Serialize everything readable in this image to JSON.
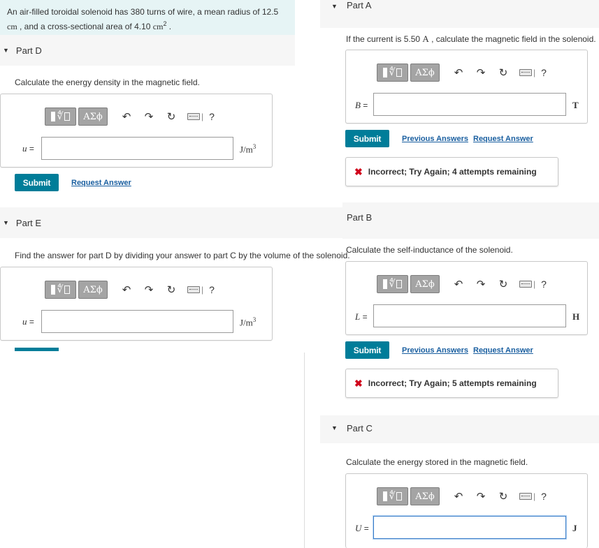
{
  "problem": {
    "line1": "An air-filled toroidal solenoid has 380 turns of wire, a mean radius of 12.5",
    "unit_cm": "cm",
    "line2_mid": " , and a cross-sectional area of 4.10 ",
    "unit_cm2": "cm",
    "sup2": "2",
    "line2_end": " ."
  },
  "toolbar": {
    "greek": "ΑΣϕ",
    "help": "?"
  },
  "partD": {
    "title": "Part D",
    "prompt": "Calculate the energy density in the magnetic field.",
    "var": "u",
    "eq": " =",
    "unit": "J/m",
    "unit_sup": "3",
    "submit": "Submit",
    "request": "Request Answer"
  },
  "partE": {
    "title": "Part E",
    "prompt": "Find the answer for part D by dividing your answer to part C by the volume of the solenoid.",
    "var": "u",
    "eq": " =",
    "unit": "J/m",
    "unit_sup": "3"
  },
  "partA": {
    "title": "Part A",
    "prompt_pre": "If the current is 5.50 ",
    "prompt_unit": "A",
    "prompt_post": " , calculate the magnetic field in the solenoid.",
    "var": "B",
    "eq": " =",
    "unit": "T",
    "submit": "Submit",
    "previous": "Previous Answers",
    "request": "Request Answer",
    "feedback": "Incorrect; Try Again; 4 attempts remaining"
  },
  "partB": {
    "title": "Part B",
    "prompt": "Calculate the self-inductance of the solenoid.",
    "var": "L",
    "eq": " =",
    "unit": "H",
    "submit": "Submit",
    "previous": "Previous Answers",
    "request": "Request Answer",
    "feedback": "Incorrect; Try Again; 5 attempts remaining"
  },
  "partC": {
    "title": "Part C",
    "prompt": "Calculate the energy stored in the magnetic field.",
    "var": "U",
    "eq": " =",
    "unit": "J"
  },
  "colors": {
    "accent": "#007d99",
    "link": "#1a5fa0",
    "error": "#d0021b",
    "problem_bg": "#e6f4f5"
  }
}
